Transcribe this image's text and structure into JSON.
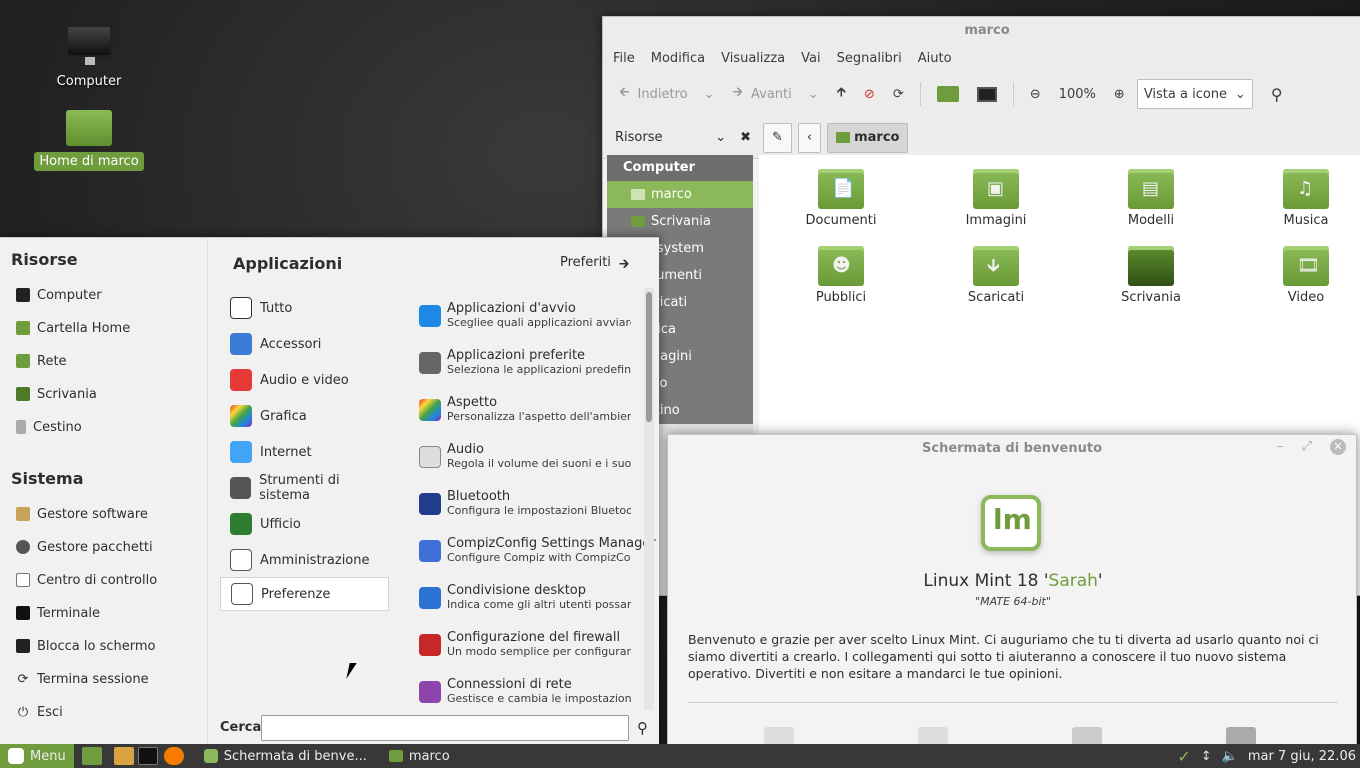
{
  "desktop": {
    "icons": [
      {
        "label": "Computer"
      },
      {
        "label": "Home di marco"
      }
    ]
  },
  "file_manager": {
    "title": "marco",
    "menu": [
      "File",
      "Modifica",
      "Visualizza",
      "Vai",
      "Segnalibri",
      "Aiuto"
    ],
    "toolbar": {
      "back": "Indietro",
      "forward": "Avanti",
      "zoom": "100%",
      "view_mode": "Vista a icone"
    },
    "location": {
      "side_pane_label": "Risorse",
      "current_folder": "marco"
    },
    "sidebar": {
      "header": "Computer",
      "items": [
        "marco",
        "Scrivania",
        "File system",
        "Documenti",
        "Scaricati",
        "Musica",
        "Immagini",
        "Video",
        "Cestino"
      ]
    },
    "folders": [
      "Documenti",
      "Immagini",
      "Modelli",
      "Musica",
      "Pubblici",
      "Scaricati",
      "Scrivania",
      "Video"
    ]
  },
  "welcome": {
    "title": "Schermata di benvenuto",
    "product_prefix": "Linux Mint 18 '",
    "product_codename": "Sarah",
    "product_suffix": "'",
    "edition": "\"MATE 64-bit\"",
    "body": "Benvenuto e grazie per aver scelto Linux Mint. Ci auguriamo che tu ti diverta ad usarlo quanto noi ci siamo divertiti a crearlo. I collegamenti qui sotto ti aiuteranno a conoscere il tuo nuovo sistema operativo. Divertiti e non esitare a mandarci le tue opinioni."
  },
  "menu": {
    "places_header": "Risorse",
    "places": [
      "Computer",
      "Cartella Home",
      "Rete",
      "Scrivania",
      "Cestino"
    ],
    "system_header": "Sistema",
    "system": [
      "Gestore software",
      "Gestore pacchetti",
      "Centro di controllo",
      "Terminale",
      "Blocca lo schermo",
      "Termina sessione",
      "Esci"
    ],
    "apps_header": "Applicazioni",
    "favorites_label": "Preferiti",
    "categories": [
      "Tutto",
      "Accessori",
      "Audio e video",
      "Grafica",
      "Internet",
      "Strumenti di sistema",
      "Ufficio",
      "Amministrazione",
      "Preferenze"
    ],
    "selected_category": "Preferenze",
    "apps": [
      {
        "name": "Applicazioni d'avvio",
        "desc": "Scegliee quali applicazioni avviare q..."
      },
      {
        "name": "Applicazioni preferite",
        "desc": "Seleziona le applicazioni predefinite"
      },
      {
        "name": "Aspetto",
        "desc": "Personalizza l'aspetto dell'ambient..."
      },
      {
        "name": "Audio",
        "desc": "Regola il volume dei suoni e i suoni ..."
      },
      {
        "name": "Bluetooth",
        "desc": "Configura le impostazioni Bluetooth"
      },
      {
        "name": "CompizConfig Settings Manager",
        "desc": "Configure Compiz with CompizConfig"
      },
      {
        "name": "Condivisione desktop",
        "desc": "Indica come gli altri utenti possano ..."
      },
      {
        "name": "Configurazione del firewall",
        "desc": "Un modo semplice per configurare i..."
      },
      {
        "name": "Connessioni di rete",
        "desc": "Gestisce e cambia le impostazioni d..."
      }
    ],
    "search_label": "Cerca:",
    "search_value": ""
  },
  "panel": {
    "menu_label": "Menu",
    "tasks": [
      "Schermata di benve...",
      "marco"
    ],
    "clock": "mar 7 giu, 22.06"
  },
  "colors": {
    "accent": "#6f9d3d",
    "panel": "#383838"
  }
}
